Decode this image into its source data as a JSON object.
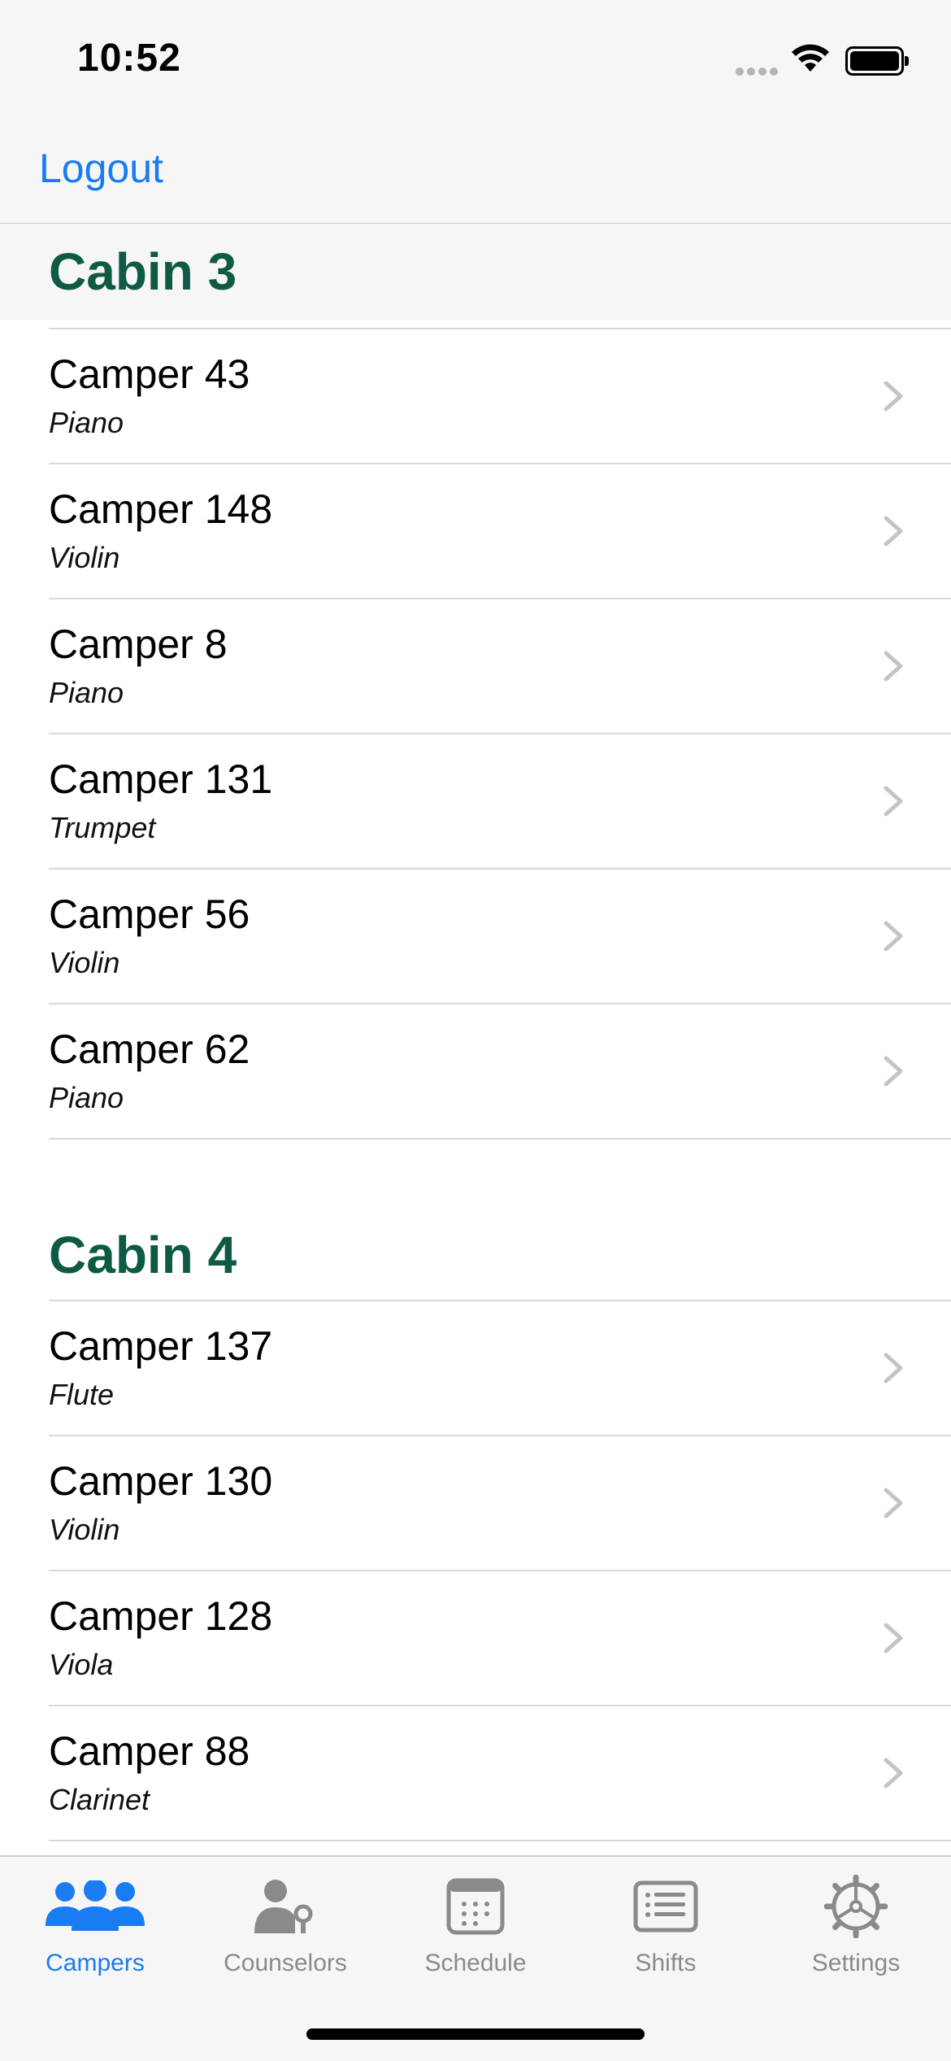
{
  "status_bar": {
    "time": "10:52"
  },
  "nav": {
    "logout_label": "Logout"
  },
  "sections": [
    {
      "title": "Cabin 3",
      "campers": [
        {
          "name": "Camper 43",
          "instrument": "Piano"
        },
        {
          "name": "Camper 148",
          "instrument": "Violin"
        },
        {
          "name": "Camper 8",
          "instrument": "Piano"
        },
        {
          "name": "Camper 131",
          "instrument": "Trumpet"
        },
        {
          "name": "Camper 56",
          "instrument": "Violin"
        },
        {
          "name": "Camper 62",
          "instrument": "Piano"
        }
      ]
    },
    {
      "title": "Cabin 4",
      "campers": [
        {
          "name": "Camper 137",
          "instrument": "Flute"
        },
        {
          "name": "Camper 130",
          "instrument": "Violin"
        },
        {
          "name": "Camper 128",
          "instrument": "Viola"
        },
        {
          "name": "Camper 88",
          "instrument": "Clarinet"
        }
      ]
    }
  ],
  "tabs": [
    {
      "label": "Campers",
      "icon": "people-icon",
      "active": true
    },
    {
      "label": "Counselors",
      "icon": "person-key-icon",
      "active": false
    },
    {
      "label": "Schedule",
      "icon": "calendar-icon",
      "active": false
    },
    {
      "label": "Shifts",
      "icon": "list-icon",
      "active": false
    },
    {
      "label": "Settings",
      "icon": "gear-icon",
      "active": false
    }
  ],
  "colors": {
    "accent": "#1a7cf2",
    "section_header": "#0e5a44",
    "inactive_tab": "#8a8a8a",
    "chevron": "#c4c4c8"
  }
}
